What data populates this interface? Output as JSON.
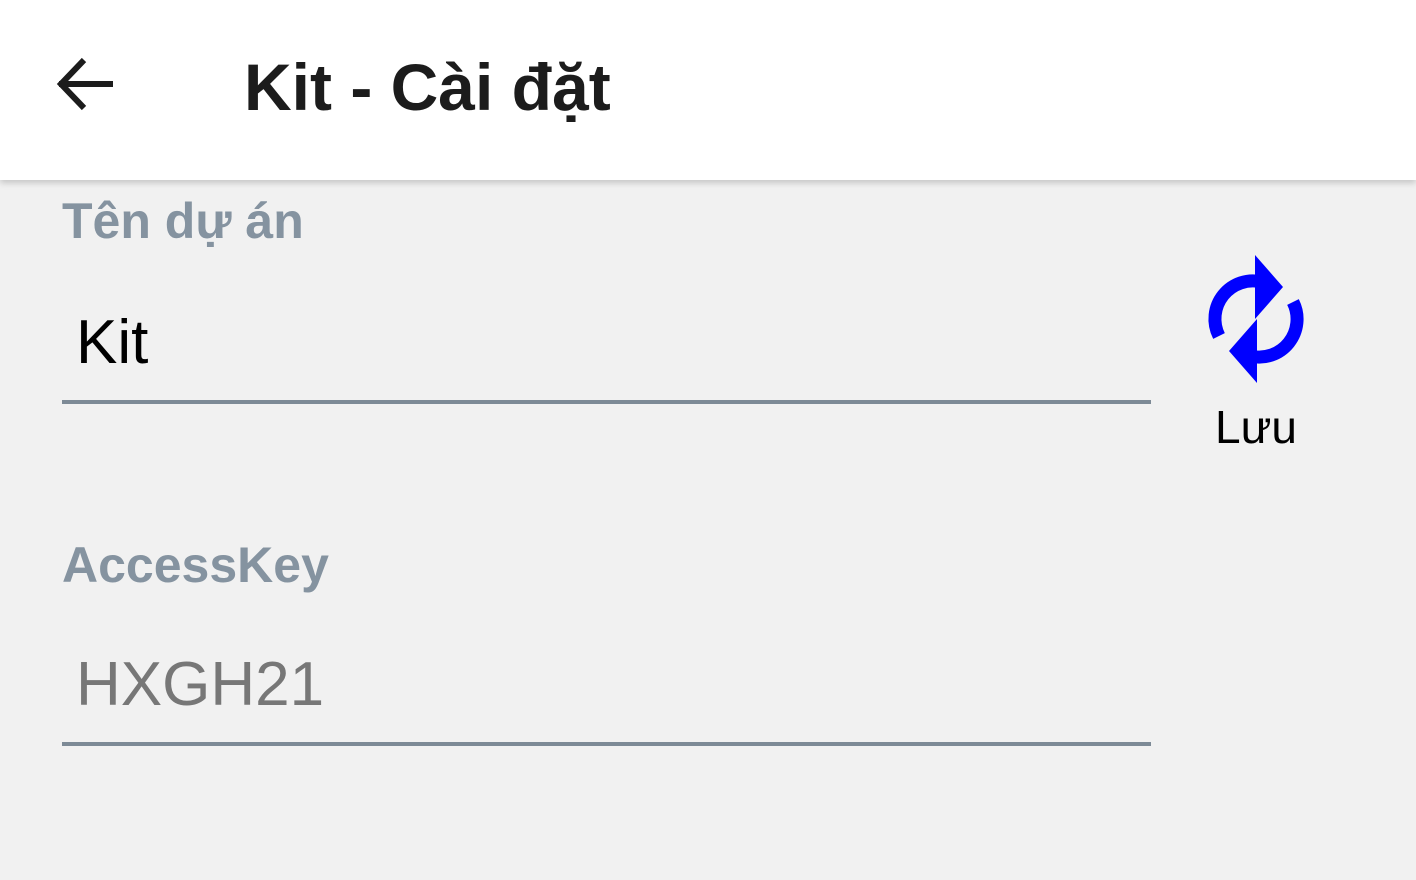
{
  "appbar": {
    "title": "Kit - Cài đặt",
    "back_icon": "arrow-left-icon"
  },
  "form": {
    "project_name": {
      "label": "Tên dự án",
      "value": "Kit"
    },
    "access_key": {
      "label": "AccessKey",
      "value": "",
      "placeholder": "HXGH21"
    }
  },
  "save_button": {
    "label": "Lưu",
    "icon": "refresh-icon",
    "icon_color": "#0000ff"
  },
  "colors": {
    "background": "#f1f1f1",
    "appbar": "#ffffff",
    "label": "#8593a0",
    "underline": "#7d8a96"
  }
}
